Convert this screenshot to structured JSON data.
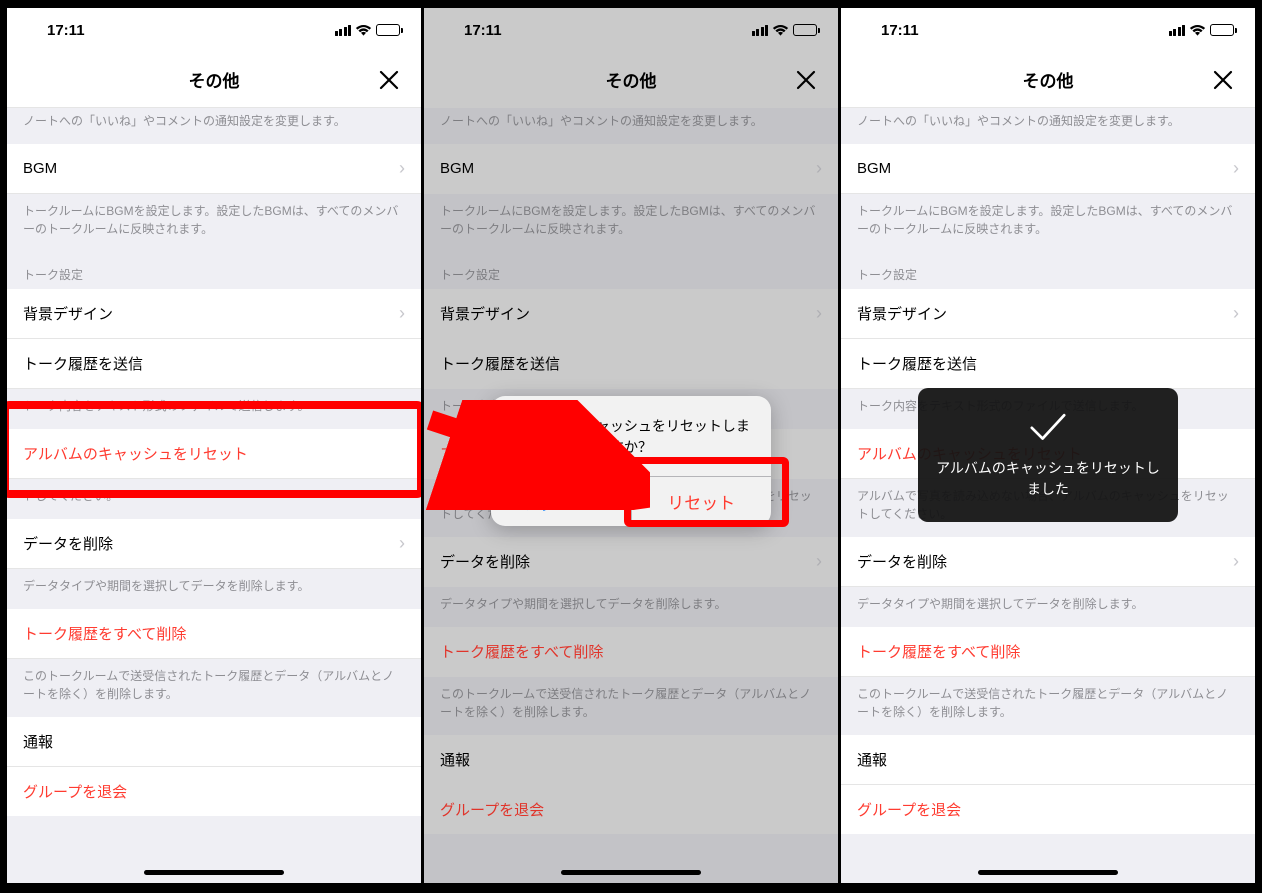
{
  "status": {
    "time": "17:11"
  },
  "nav": {
    "title": "その他"
  },
  "rows": {
    "notes_desc": "ノートへの「いいね」やコメントの通知設定を変更します。",
    "bgm": "BGM",
    "bgm_desc": "トークルームにBGMを設定します。設定したBGMは、すべてのメンバーのトークルームに反映されます。",
    "talk_section": "トーク設定",
    "background": "背景デザイン",
    "send_history": "トーク履歴を送信",
    "send_history_desc": "トーク内容をテキスト形式のファイルで送信します。",
    "reset_cache": "アルバムのキャッシュをリセット",
    "reset_cache_desc_partial": "トしてください。",
    "reset_cache_desc_full": "アルバムで写真を読み込めない場合、アルバムのキャッシュをリセットしてください。",
    "delete_data": "データを削除",
    "delete_data_desc": "データタイプや期間を選択してデータを削除します。",
    "delete_all_history": "トーク履歴をすべて削除",
    "delete_all_history_desc": "このトークルームで送受信されたトーク履歴とデータ（アルバムとノートを除く）を削除します。",
    "report": "通報",
    "leave_group": "グループを退会"
  },
  "alert": {
    "title": "アルバムのキャッシュをリセットしますか？",
    "cancel": "キャンセル",
    "confirm": "リセット"
  },
  "toast": {
    "text": "アルバムのキャッシュをリセットしました"
  }
}
